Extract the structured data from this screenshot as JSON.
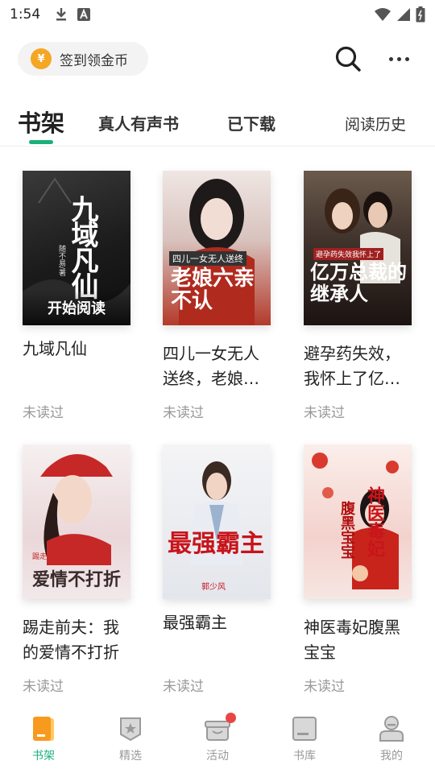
{
  "status_bar": {
    "time": "1:54"
  },
  "header": {
    "checkin_icon": "¥",
    "checkin_label": "签到领金币"
  },
  "tabs": [
    {
      "label": "书架",
      "active": true
    },
    {
      "label": "真人有声书",
      "active": false
    },
    {
      "label": "已下载",
      "active": false
    },
    {
      "label": "阅读历史",
      "active": false
    }
  ],
  "books": [
    {
      "title": "九域凡仙",
      "status": "未读过",
      "cover_text": "九域凡仙",
      "cover_author": "随不易/著",
      "cover_overlay": "开始阅读"
    },
    {
      "title": "四儿一女无人送终，老娘…",
      "title_line1": "四儿一女无人",
      "title_line2": "送终，老娘…",
      "status": "未读过",
      "cover_text": "老娘六亲不认",
      "cover_sub": "四儿一女无人送终"
    },
    {
      "title": "避孕药失效，我怀上了亿…",
      "title_line1": "避孕药失效，",
      "title_line2": "我怀上了亿…",
      "status": "未读过",
      "cover_text": "亿万总裁的继承人",
      "cover_sub": "避孕药失效我怀上了"
    },
    {
      "title": "踢走前夫：我的爱情不打折",
      "title_line1": "踢走前夫：我",
      "title_line2": "的爱情不打折",
      "status": "未读过",
      "cover_text": "爱情不打折",
      "cover_sub": "踢走前夫"
    },
    {
      "title": "最强霸主",
      "status": "未读过",
      "cover_text": "最强霸主",
      "cover_sub": "郭少风"
    },
    {
      "title": "神医毒妃腹黑宝宝",
      "title_line1": "神医毒妃腹黑",
      "title_line2": "宝宝",
      "status": "未读过",
      "cover_text": "神医毒妃",
      "cover_sub": "腹黑宝宝"
    }
  ],
  "bottom_nav": [
    {
      "label": "书架",
      "icon": "bookshelf-icon",
      "active": true
    },
    {
      "label": "精选",
      "icon": "featured-icon",
      "active": false
    },
    {
      "label": "活动",
      "icon": "gift-icon",
      "active": false,
      "badge": true
    },
    {
      "label": "书库",
      "icon": "library-icon",
      "active": false
    },
    {
      "label": "我的",
      "icon": "profile-icon",
      "active": false
    }
  ],
  "colors": {
    "accent": "#1bb07a",
    "badge": "#e94545",
    "coin": "#f5a623",
    "muted": "#999999"
  }
}
